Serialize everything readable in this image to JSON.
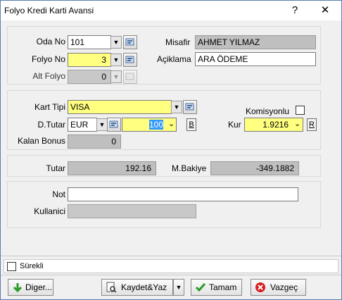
{
  "window": {
    "title": "Folyo Kredi Karti Avansi",
    "help_glyph": "?",
    "close_glyph": "✕"
  },
  "room_section": {
    "oda_no_label": "Oda No",
    "oda_no_value": "101",
    "folyo_no_label": "Folyo No",
    "folyo_no_value": "3",
    "alt_folyo_label": "Alt Folyo",
    "alt_folyo_value": "0",
    "misafir_label": "Misafir",
    "misafir_value": "AHMET YILMAZ",
    "aciklama_label": "Açiklama",
    "aciklama_value": "ARA ÖDEME"
  },
  "card_section": {
    "kart_tipi_label": "Kart Tipi",
    "kart_tipi_value": "VISA",
    "komisyonlu_label": "Komisyonlu",
    "komisyonlu_checked": false,
    "d_tutar_label": "D.Tutar",
    "currency_value": "EUR",
    "amount_value": "100",
    "b_button": "B",
    "kur_label": "Kur",
    "kur_value": "1.9216",
    "r_button": "R",
    "kalan_bonus_label": "Kalan Bonus",
    "kalan_bonus_value": "0"
  },
  "totals": {
    "tutar_label": "Tutar",
    "tutar_value": "192.16",
    "bakiye_label": "M.Bakiye",
    "bakiye_value": "-349.1882"
  },
  "note_section": {
    "not_label": "Not",
    "not_value": "",
    "kullanici_label": "Kullanici",
    "kullanici_value": ""
  },
  "footer": {
    "surekli_label": "Sürekli",
    "surekli_checked": false,
    "diger_label": "Diger...",
    "kaydet_label": "Kaydet&Yaz",
    "tamam_label": "Tamam",
    "vazgec_label": "Vazgeç"
  },
  "colors": {
    "required_field": "#ffff80",
    "readonly_field": "#bfbfbf",
    "panel_bg": "#f0f0f0"
  }
}
